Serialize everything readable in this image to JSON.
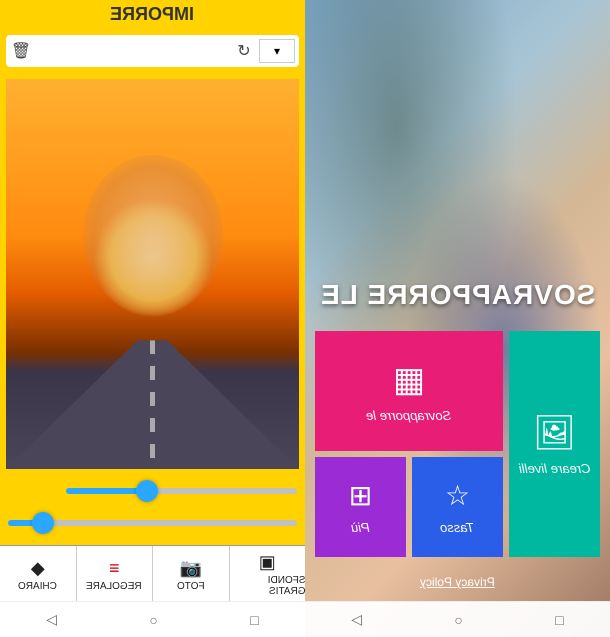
{
  "left": {
    "title": "IMPORRE",
    "toolbar": {
      "delete_icon": "delete-icon",
      "refresh_icon": "refresh-icon"
    },
    "sliders": {
      "top_value": 35,
      "bottom_value": 12
    },
    "tabs": [
      {
        "label": "CHIARO",
        "icon": "diamond-icon"
      },
      {
        "label": "REGOLARE",
        "icon": "settings-icon"
      },
      {
        "label": "FOTO",
        "icon": "camera-icon"
      },
      {
        "label": "SFONDI GRATIS",
        "icon": "layers-icon"
      }
    ]
  },
  "right": {
    "title": "SOVRAPPORRE LE",
    "tiles": {
      "overlay": {
        "label": "Sovrapporre le",
        "color": "#e81d76"
      },
      "create": {
        "label": "Creare livelli",
        "color": "#00b8a0"
      },
      "more": {
        "label": "Più",
        "color": "#9b2bd4"
      },
      "rate": {
        "label": "Tasso",
        "color": "#2a5ee8"
      }
    },
    "privacy_label": "Privacy Policy"
  }
}
